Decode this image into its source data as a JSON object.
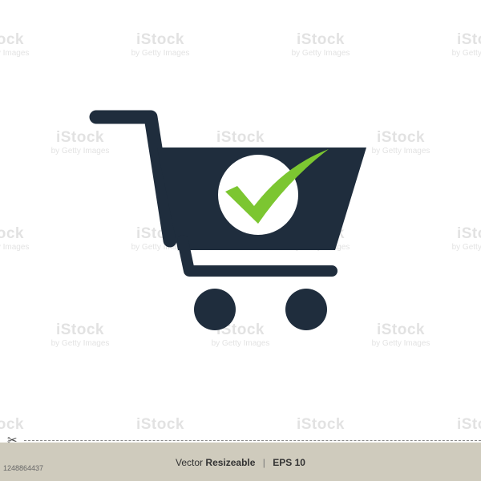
{
  "watermark": {
    "brand": "iStock",
    "credit": "by Getty Images"
  },
  "icon": {
    "name": "shopping-cart-with-checkmark",
    "cart_color": "#1f2d3d",
    "check_color": "#7cc631",
    "circle_color": "#ffffff"
  },
  "footer": {
    "vector": "Vector",
    "resizeable": "Resizeable",
    "format": "EPS 10",
    "separator": "|",
    "image_id": "1248864437",
    "background": "#cfcbbd"
  }
}
